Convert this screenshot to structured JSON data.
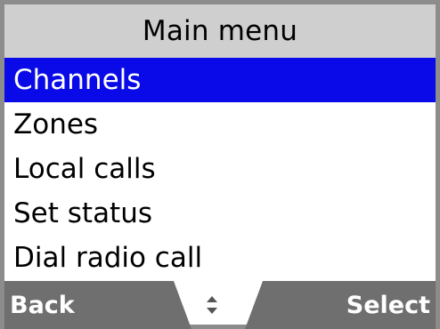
{
  "title": "Main menu",
  "menu": {
    "items": [
      {
        "label": "Channels",
        "selected": true
      },
      {
        "label": "Zones",
        "selected": false
      },
      {
        "label": "Local calls",
        "selected": false
      },
      {
        "label": "Set status",
        "selected": false
      },
      {
        "label": "Dial radio call",
        "selected": false
      }
    ]
  },
  "softkeys": {
    "left_label": "Back",
    "right_label": "Select",
    "center_icon": "up-down-arrows-icon"
  },
  "colors": {
    "selection": "#0a0ae8",
    "title_bar": "#cfcfcf",
    "softkey_bar": "#6f6f6f",
    "border": "#8c8c8c"
  }
}
